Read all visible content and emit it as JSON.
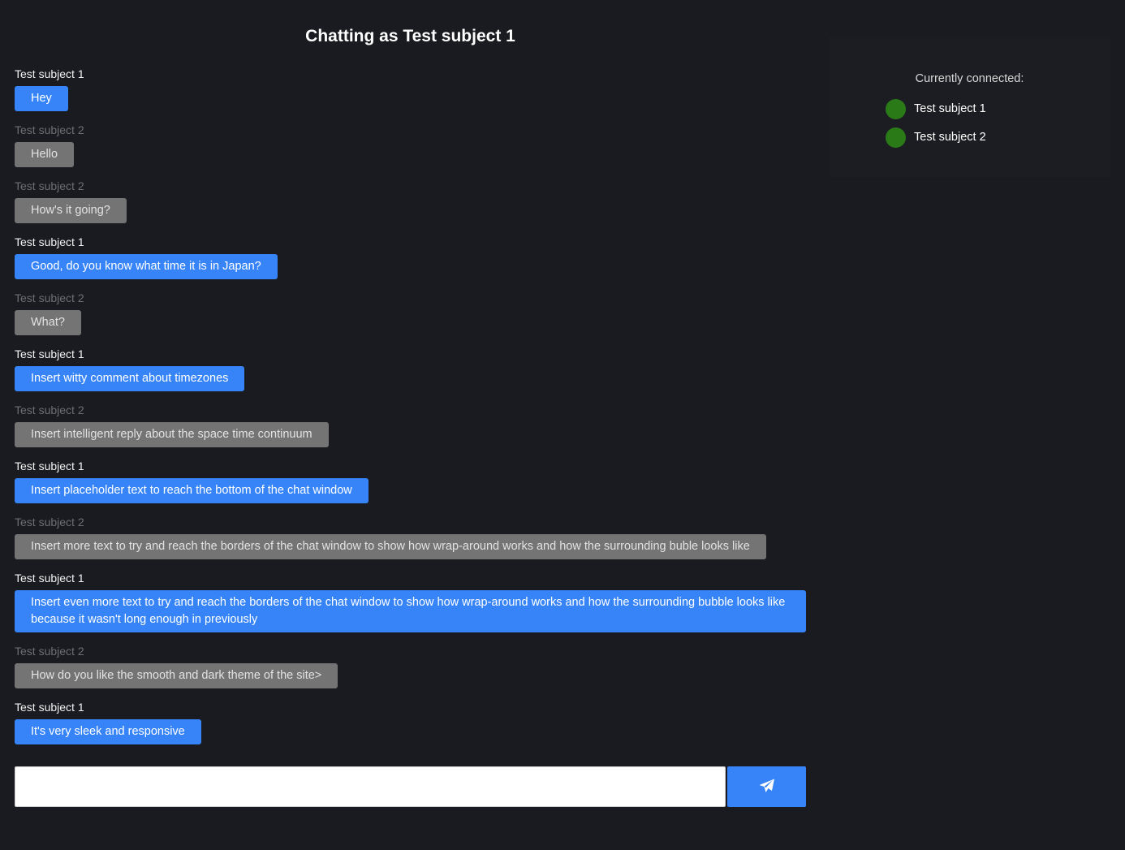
{
  "chat": {
    "title": "Chatting as Test subject 1",
    "messages": [
      {
        "sender": "Test subject 1",
        "text": "Hey",
        "self": true
      },
      {
        "sender": "Test subject 2",
        "text": "Hello",
        "self": false
      },
      {
        "sender": "Test subject 2",
        "text": "How's it going?",
        "self": false
      },
      {
        "sender": "Test subject 1",
        "text": "Good, do you know what time it is in Japan?",
        "self": true
      },
      {
        "sender": "Test subject 2",
        "text": "What?",
        "self": false
      },
      {
        "sender": "Test subject 1",
        "text": "Insert witty comment about timezones",
        "self": true
      },
      {
        "sender": "Test subject 2",
        "text": "Insert intelligent reply about the space time continuum",
        "self": false
      },
      {
        "sender": "Test subject 1",
        "text": "Insert placeholder text to reach the bottom of the chat window",
        "self": true
      },
      {
        "sender": "Test subject 2",
        "text": "Insert more text to try and reach the borders of the chat window to show how wrap-around works and how the surrounding buble looks like",
        "self": false
      },
      {
        "sender": "Test subject 1",
        "text": "Insert even more text to try and reach the borders of the chat window to show how wrap-around works and how the surrounding bubble looks like because it wasn't long enough in previously",
        "self": true
      },
      {
        "sender": "Test subject 2",
        "text": "How do you like the smooth and dark theme of the site>",
        "self": false
      },
      {
        "sender": "Test subject 1",
        "text": "It's very sleek and responsive",
        "self": true
      }
    ]
  },
  "composer": {
    "input_value": "",
    "send_icon": "paper-plane-icon"
  },
  "connected": {
    "heading": "Currently connected:",
    "users": [
      {
        "name": "Test subject 1",
        "status": "online"
      },
      {
        "name": "Test subject 2",
        "status": "online"
      }
    ]
  },
  "colors": {
    "background": "#1a1b20",
    "self_bubble": "#3684f7",
    "other_bubble": "#747474",
    "online_dot": "#2a7a18"
  }
}
